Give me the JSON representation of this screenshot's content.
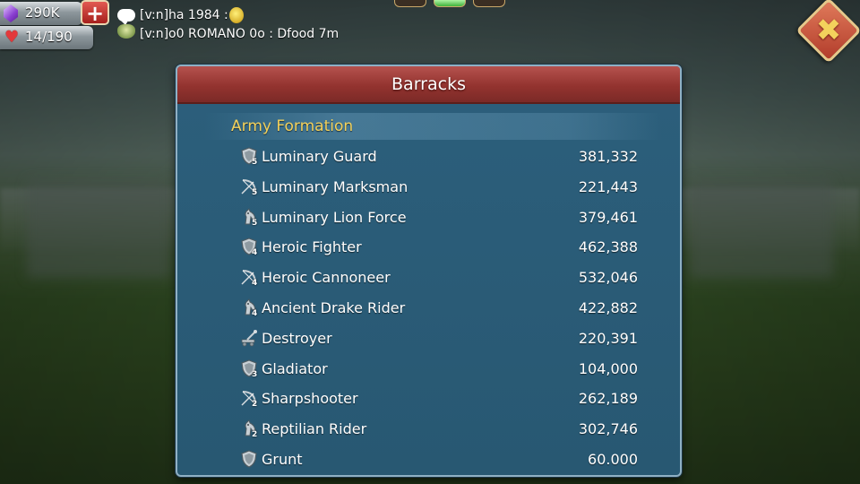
{
  "resources": {
    "gems": "290K",
    "hp": "14/190",
    "plus_label": "+"
  },
  "chat": {
    "line1": "[v:n]ha 1984 :",
    "line2": "[v:n]o0 ROMANO 0o : Dfood 7m"
  },
  "pager": {
    "pages": 3,
    "active": 2
  },
  "close_label": "✖",
  "panel": {
    "title": "Barracks",
    "section_title": "Army Formation",
    "troops": [
      {
        "name": "Luminary Guard",
        "count": "381,332",
        "icon": "infantry-shield-icon",
        "tier": "5"
      },
      {
        "name": "Luminary Marksman",
        "count": "221,443",
        "icon": "ranged-bow-icon",
        "tier": "5"
      },
      {
        "name": "Luminary Lion Force",
        "count": "379,461",
        "icon": "cavalry-horse-icon",
        "tier": "5"
      },
      {
        "name": "Heroic Fighter",
        "count": "462,388",
        "icon": "infantry-shield-icon",
        "tier": "4"
      },
      {
        "name": "Heroic Cannoneer",
        "count": "532,046",
        "icon": "ranged-bow-icon",
        "tier": "4"
      },
      {
        "name": "Ancient Drake Rider",
        "count": "422,882",
        "icon": "cavalry-horse-icon",
        "tier": "4"
      },
      {
        "name": "Destroyer",
        "count": "220,391",
        "icon": "siege-catapult-icon",
        "tier": ""
      },
      {
        "name": "Gladiator",
        "count": "104,000",
        "icon": "infantry-shield-icon",
        "tier": "3"
      },
      {
        "name": "Sharpshooter",
        "count": "262,189",
        "icon": "ranged-bow-icon",
        "tier": "2"
      },
      {
        "name": "Reptilian Rider",
        "count": "302,746",
        "icon": "cavalry-horse-icon",
        "tier": "2"
      },
      {
        "name": "Grunt",
        "count": "60.000",
        "icon": "infantry-shield-icon",
        "tier": ""
      }
    ]
  }
}
